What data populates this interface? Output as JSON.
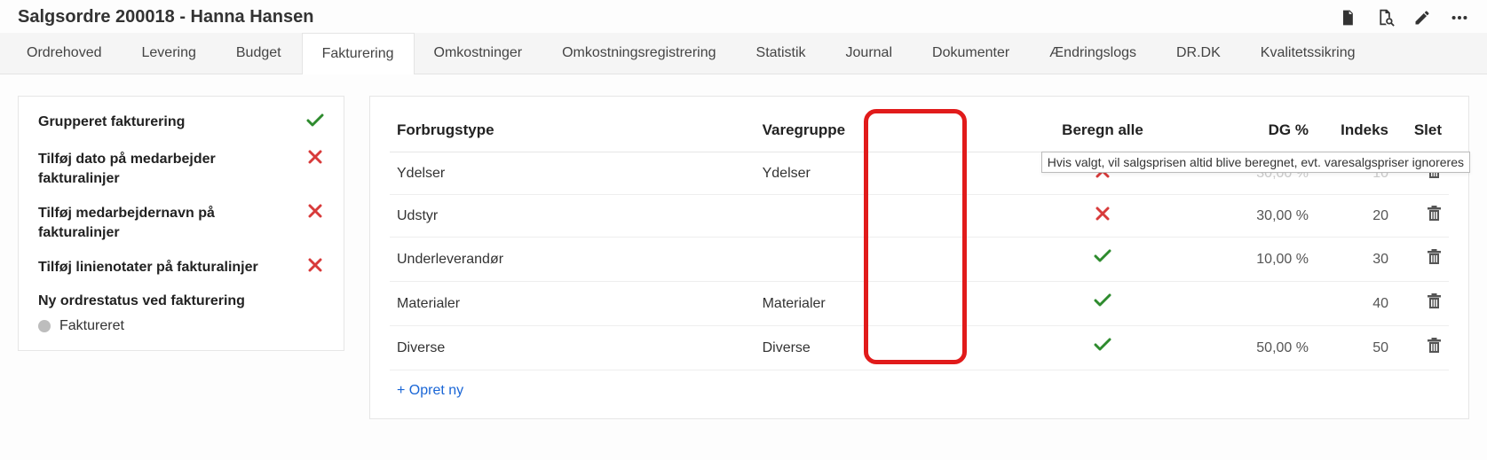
{
  "header": {
    "title": "Salgsordre 200018 - Hanna Hansen"
  },
  "tabs": [
    {
      "label": "Ordrehoved",
      "active": false
    },
    {
      "label": "Levering",
      "active": false
    },
    {
      "label": "Budget",
      "active": false
    },
    {
      "label": "Fakturering",
      "active": true
    },
    {
      "label": "Omkostninger",
      "active": false
    },
    {
      "label": "Omkostningsregistrering",
      "active": false
    },
    {
      "label": "Statistik",
      "active": false
    },
    {
      "label": "Journal",
      "active": false
    },
    {
      "label": "Dokumenter",
      "active": false
    },
    {
      "label": "Ændringslogs",
      "active": false
    },
    {
      "label": "DR.DK",
      "active": false
    },
    {
      "label": "Kvalitetssikring",
      "active": false
    }
  ],
  "settings": [
    {
      "label": "Grupperet fakturering",
      "on": true
    },
    {
      "label": "Tilføj dato på medarbejder fakturalinjer",
      "on": false
    },
    {
      "label": "Tilføj medarbejdernavn på fakturalinjer",
      "on": false
    },
    {
      "label": "Tilføj linienotater på fakturalinjer",
      "on": false
    }
  ],
  "status": {
    "label": "Ny ordrestatus ved fakturering",
    "value": "Faktureret"
  },
  "table": {
    "columns": {
      "forbrugstype": "Forbrugstype",
      "varegruppe": "Varegruppe",
      "beregn": "Beregn alle",
      "dg": "DG %",
      "indeks": "Indeks",
      "slet": "Slet"
    },
    "rows": [
      {
        "forbrugstype": "Ydelser",
        "varegruppe": "Ydelser",
        "beregn": false,
        "dg": "30,00 %",
        "indeks": "10",
        "dimmed": true
      },
      {
        "forbrugstype": "Udstyr",
        "varegruppe": "",
        "beregn": false,
        "dg": "30,00 %",
        "indeks": "20",
        "dimmed": false
      },
      {
        "forbrugstype": "Underleverandør",
        "varegruppe": "",
        "beregn": true,
        "dg": "10,00 %",
        "indeks": "30",
        "dimmed": false
      },
      {
        "forbrugstype": "Materialer",
        "varegruppe": "Materialer",
        "beregn": true,
        "dg": "",
        "indeks": "40",
        "dimmed": false
      },
      {
        "forbrugstype": "Diverse",
        "varegruppe": "Diverse",
        "beregn": true,
        "dg": "50,00 %",
        "indeks": "50",
        "dimmed": false
      }
    ],
    "create_label": "+ Opret ny"
  },
  "tooltip": "Hvis valgt, vil salgsprisen altid blive beregnet, evt. varesalgspriser ignoreres",
  "colors": {
    "green": "#2e8b2e",
    "red": "#d83b3b",
    "accent_red": "#e11b1b",
    "link": "#1a66d6"
  }
}
